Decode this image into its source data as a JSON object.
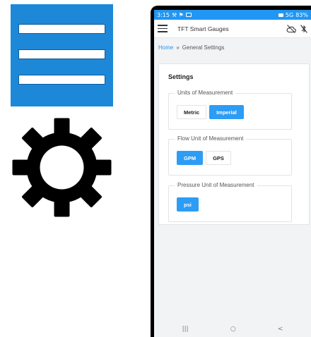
{
  "icons": {
    "menu_tile": "hamburger-menu-icon",
    "gear": "gear-icon",
    "accent": "#1e88d8"
  },
  "status_bar": {
    "time": "3:15",
    "left_glyphs": "⚒ ⚑",
    "network": "5G",
    "battery": "83%"
  },
  "app_bar": {
    "title": "TFT Smart Gauges",
    "icons": [
      "cloud-off-icon",
      "bluetooth-off-icon"
    ]
  },
  "breadcrumb": {
    "home": "Home",
    "separator": "»",
    "current": "General Settings"
  },
  "settings": {
    "title": "Settings",
    "groups": [
      {
        "legend": "Units of Measurement",
        "options": [
          "Metric",
          "Imperial"
        ],
        "selected": "Imperial"
      },
      {
        "legend": "Flow Unit of Measurement",
        "options": [
          "GPM",
          "GPS"
        ],
        "selected": "GPM"
      },
      {
        "legend": "Pressure Unit of Measurement",
        "options": [
          "psi"
        ],
        "selected": "psi"
      }
    ]
  },
  "nav_bar": {
    "recents": "|||",
    "home": "○",
    "back": "<"
  },
  "colors": {
    "primary": "#2196f3",
    "selected_button": "#2d9cf5"
  }
}
